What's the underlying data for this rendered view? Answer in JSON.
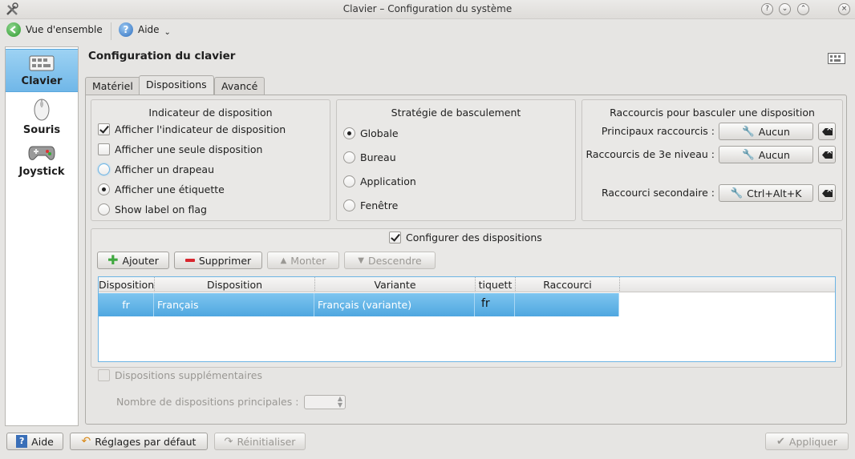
{
  "window": {
    "title": "Clavier – Configuration du système"
  },
  "toolbar": {
    "overview_label": "Vue d'ensemble",
    "help_label": "Aide"
  },
  "sidebar": {
    "items": [
      {
        "label": "Clavier"
      },
      {
        "label": "Souris"
      },
      {
        "label": "Joystick"
      }
    ]
  },
  "page": {
    "title": "Configuration du clavier"
  },
  "tabs": [
    {
      "label": "Matériel"
    },
    {
      "label": "Dispositions"
    },
    {
      "label": "Avancé"
    }
  ],
  "indicator": {
    "title": "Indicateur de disposition",
    "options": [
      {
        "label": "Afficher l'indicateur de disposition",
        "checked": true
      },
      {
        "label": "Afficher une seule disposition",
        "checked": false
      },
      {
        "label": "Afficher un drapeau",
        "selected": false
      },
      {
        "label": "Afficher une étiquette",
        "selected": true
      },
      {
        "label": "Show label on flag",
        "selected": false
      }
    ]
  },
  "switching": {
    "title": "Stratégie de basculement",
    "options": [
      {
        "label": "Globale",
        "selected": true
      },
      {
        "label": "Bureau"
      },
      {
        "label": "Application"
      },
      {
        "label": "Fenêtre"
      }
    ]
  },
  "shortcuts": {
    "title": "Raccourcis pour basculer une disposition",
    "main_label": "Principaux raccourcis :",
    "main_value": "Aucun",
    "level3_label": "Raccourcis de 3e niveau :",
    "level3_value": "Aucun",
    "secondary_label": "Raccourci secondaire :",
    "secondary_value": "Ctrl+Alt+K"
  },
  "layouts": {
    "configure_label": "Configurer des dispositions",
    "add_label": "Ajouter",
    "remove_label": "Supprimer",
    "up_label": "Monter",
    "down_label": "Descendre",
    "columns": [
      "Disposition",
      "Disposition",
      "Variante",
      "tiquett",
      "Raccourci"
    ],
    "rows": [
      {
        "map": "fr",
        "layout": "Français",
        "variant": "Français (variante)",
        "label": "fr",
        "shortcut": ""
      }
    ]
  },
  "extra": {
    "label": "Dispositions supplémentaires",
    "count_label": "Nombre de dispositions principales :"
  },
  "bottom": {
    "help_label": "Aide",
    "defaults_label": "Réglages par défaut",
    "reset_label": "Réinitialiser",
    "apply_label": "Appliquer"
  },
  "colors": {
    "selection": "#5aaee4",
    "accent_green": "#3fa83f",
    "remove_red": "#d8262e"
  }
}
